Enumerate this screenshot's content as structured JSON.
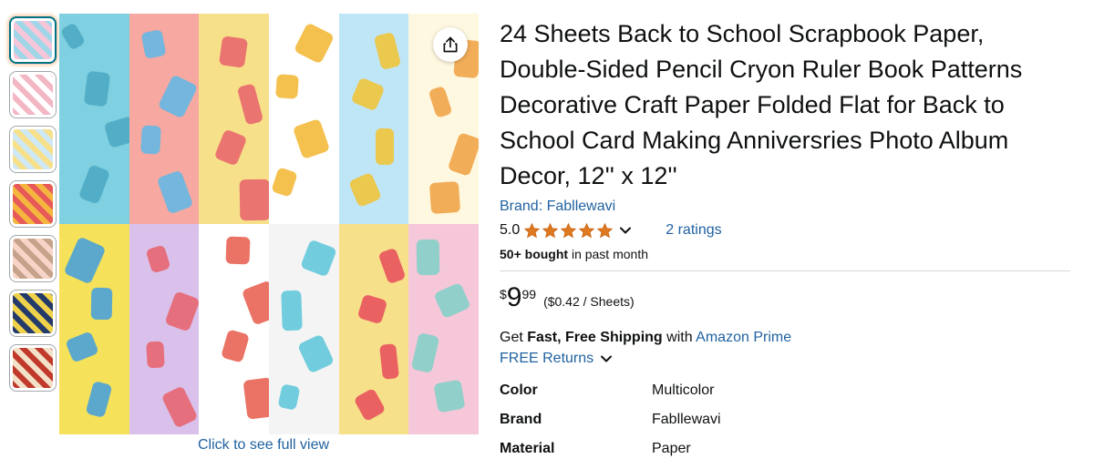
{
  "thumbnails": [
    {
      "name": "thumb-1",
      "colors": [
        "#f7c6d9",
        "#9fd7e8"
      ]
    },
    {
      "name": "thumb-2",
      "colors": [
        "#f3b7c4",
        "#ffffff"
      ]
    },
    {
      "name": "thumb-3",
      "colors": [
        "#cfe8f5",
        "#f7e08a"
      ]
    },
    {
      "name": "thumb-4",
      "colors": [
        "#f4b63f",
        "#e85a5a"
      ]
    },
    {
      "name": "thumb-5",
      "colors": [
        "#f6d4c8",
        "#c7a28a"
      ]
    },
    {
      "name": "thumb-6",
      "colors": [
        "#243a6b",
        "#f0d24a"
      ]
    },
    {
      "name": "thumb-7",
      "colors": [
        "#c0392b",
        "#f3e0c8"
      ]
    }
  ],
  "main_image": {
    "tiles": [
      {
        "bg": "#7fd0e0",
        "accent": "#4aa8c2"
      },
      {
        "bg": "#f7a8a0",
        "accent": "#5db8e8"
      },
      {
        "bg": "#f7e08a",
        "accent": "#e8606a"
      },
      {
        "bg": "#ffffff",
        "accent": "#f2b630"
      },
      {
        "bg": "#bfe6f7",
        "accent": "#f2c230"
      },
      {
        "bg": "#fff8e0",
        "accent": "#f0a040"
      },
      {
        "bg": "#f6e15a",
        "accent": "#3f9ee0"
      },
      {
        "bg": "#d9c1ec",
        "accent": "#e8606a"
      },
      {
        "bg": "#ffffff",
        "accent": "#e85a4a"
      },
      {
        "bg": "#f4f4f4",
        "accent": "#59c6d8"
      },
      {
        "bg": "#f7e08a",
        "accent": "#e84a5a"
      },
      {
        "bg": "#f6c7d9",
        "accent": "#7fd0c8"
      }
    ],
    "full_view_label": "Click to see full view"
  },
  "product": {
    "title": "24 Sheets Back to School Scrapbook Paper, Double-Sided Pencil Cryon Ruler Book Patterns Decorative Craft Paper Folded Flat for Back to School Card Making Anniversries Photo Album Decor, 12'' x 12''",
    "brand_link": "Brand: Fabllewavi",
    "rating_value": "5.0",
    "rating_stars": 5,
    "ratings_count": "2 ratings",
    "bought_bold": "50+ bought",
    "bought_rest": " in past month",
    "price_symbol": "$",
    "price_whole": "9",
    "price_fraction": "99",
    "unit_price": "($0.42 / Sheets)",
    "shipping_pre": "Get ",
    "shipping_bold": "Fast, Free Shipping",
    "shipping_mid": " with ",
    "shipping_link": "Amazon Prime",
    "returns_label": "FREE Returns"
  },
  "specs": [
    {
      "key": "Color",
      "value": "Multicolor"
    },
    {
      "key": "Brand",
      "value": "Fabllewavi"
    },
    {
      "key": "Material",
      "value": "Paper"
    }
  ],
  "colors": {
    "link": "#2162A1",
    "star": "#DE7921",
    "text": "#0F1111",
    "divider": "#d5d9d9"
  },
  "icons": {
    "share": "share-icon",
    "star": "star-icon",
    "chevron": "chevron-down-icon"
  }
}
